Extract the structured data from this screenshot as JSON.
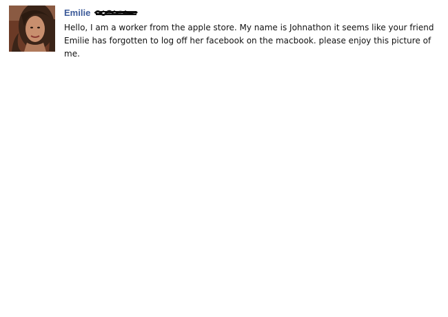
{
  "post": {
    "author": {
      "first_name": "Emilie",
      "last_name_scribbled": true,
      "name_color": "#3b5998"
    },
    "avatar": {
      "icon": "profile-photo",
      "description_colors": {
        "hair": "#3a2418",
        "skin": "#c88f6e",
        "background": "#7a4a35"
      }
    },
    "message": "Hello, I am a worker from the apple store. My name is Johnathon it seems like your friend Emilie has forgotten to log off her facebook on the macbook. please enjoy this picture of me."
  }
}
